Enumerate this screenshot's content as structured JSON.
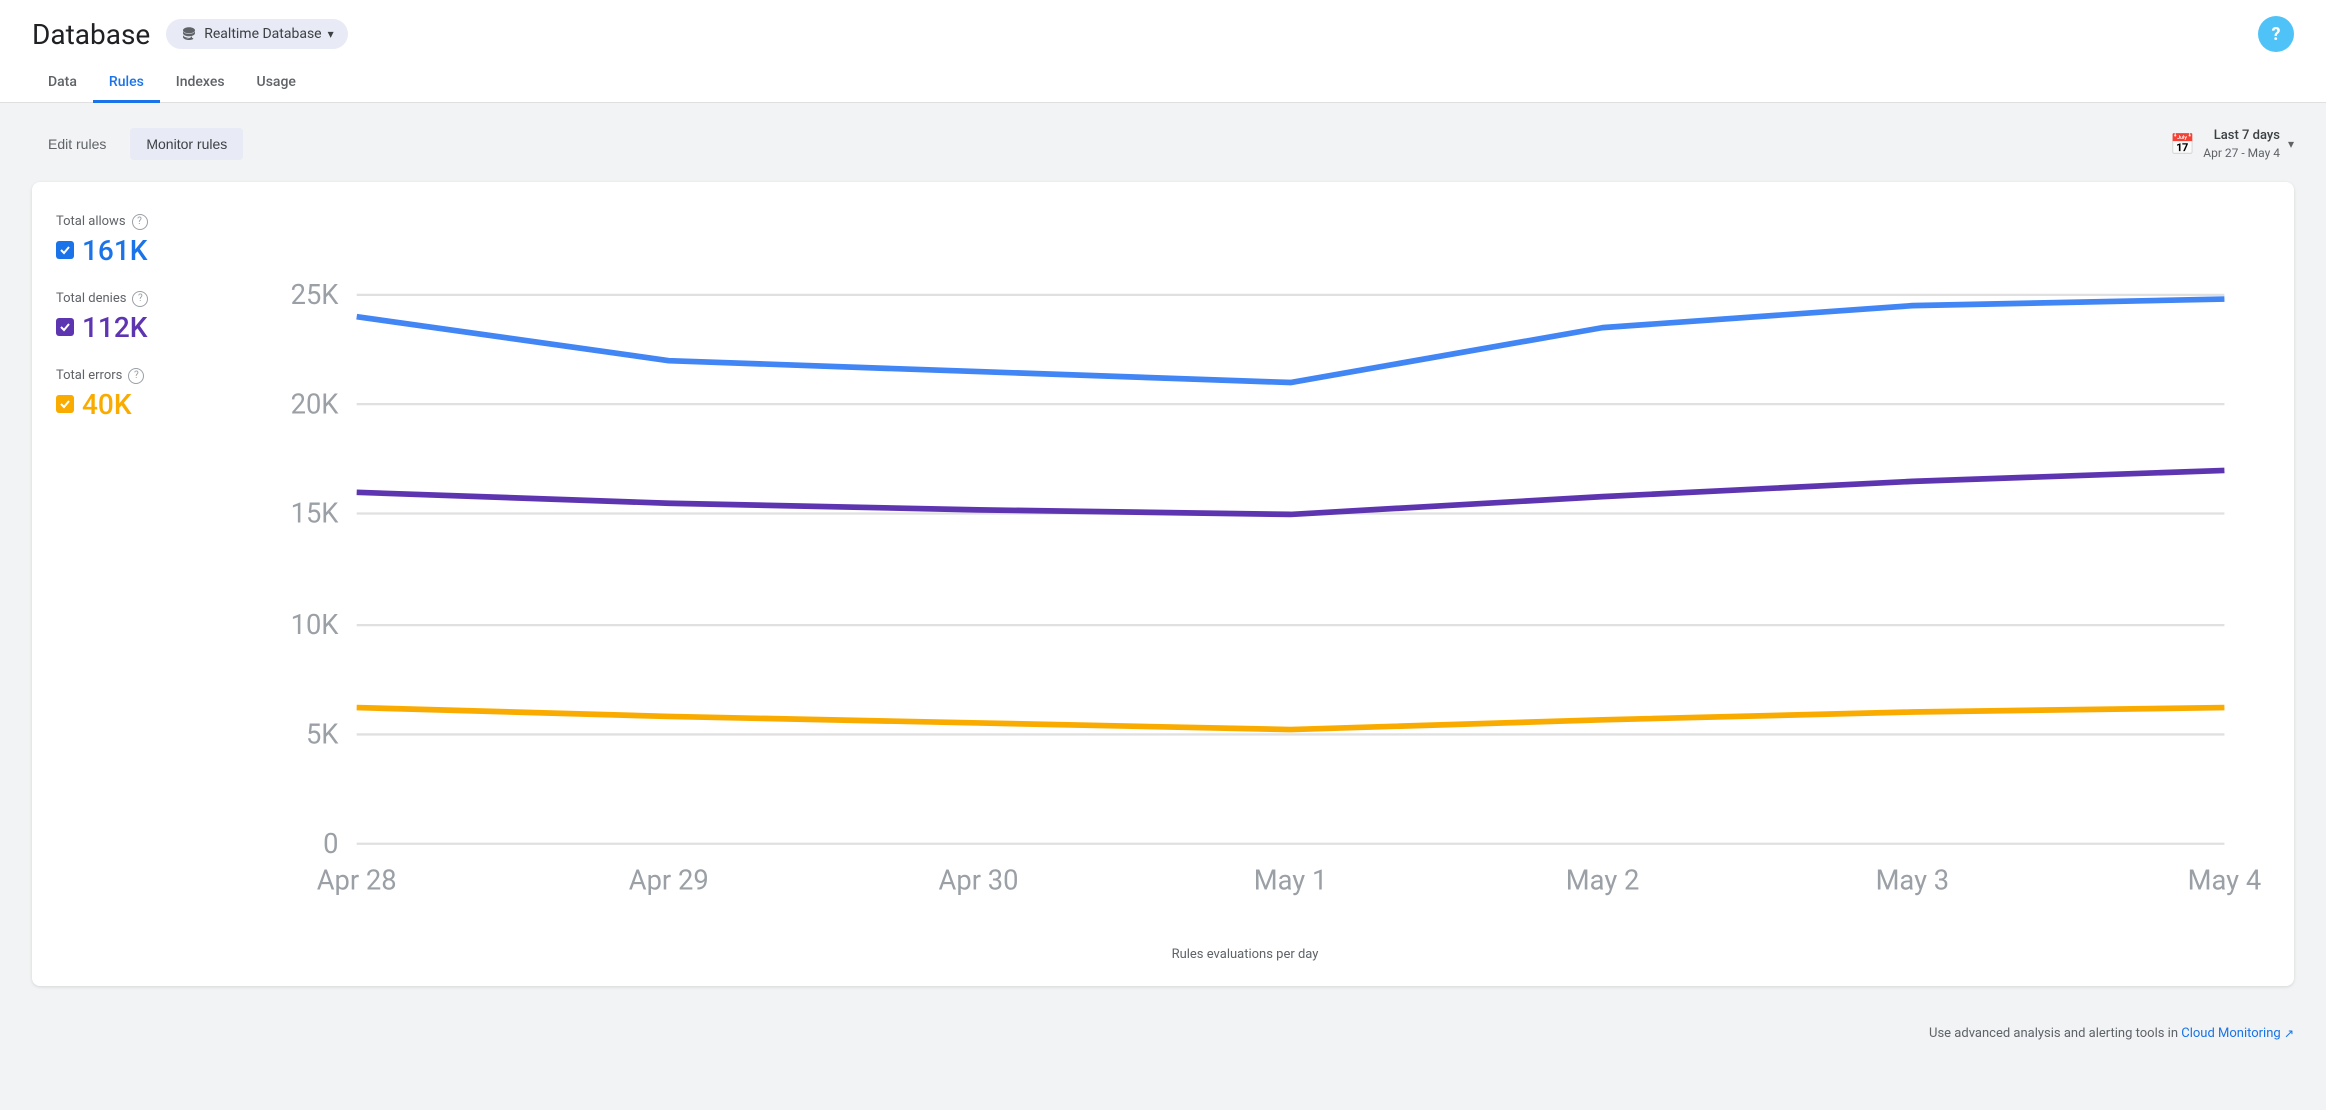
{
  "page": {
    "title": "Database",
    "help_label": "?"
  },
  "db_selector": {
    "label": "Realtime Database",
    "icon": "database-icon"
  },
  "nav": {
    "tabs": [
      {
        "id": "data",
        "label": "Data",
        "active": false
      },
      {
        "id": "rules",
        "label": "Rules",
        "active": true
      },
      {
        "id": "indexes",
        "label": "Indexes",
        "active": false
      },
      {
        "id": "usage",
        "label": "Usage",
        "active": false
      }
    ]
  },
  "toolbar": {
    "edit_rules_label": "Edit rules",
    "monitor_rules_label": "Monitor rules",
    "date_range_label": "Last 7 days",
    "date_range_sub": "Apr 27 - May 4"
  },
  "legends": {
    "allows": {
      "label": "Total allows",
      "value": "161K",
      "class": "allows"
    },
    "denies": {
      "label": "Total denies",
      "value": "112K",
      "class": "denies"
    },
    "errors": {
      "label": "Total errors",
      "value": "40K",
      "class": "errors"
    }
  },
  "chart": {
    "y_labels": [
      "25K",
      "20K",
      "15K",
      "10K",
      "5K",
      "0"
    ],
    "x_labels": [
      "Apr 28",
      "Apr 29",
      "Apr 30",
      "May 1",
      "May 2",
      "May 3",
      "May 4"
    ],
    "x_axis_label": "Rules evaluations per day",
    "series": {
      "allows": {
        "color": "#4285f4",
        "points": [
          24000,
          22000,
          21500,
          21000,
          23500,
          24500,
          24800
        ]
      },
      "denies": {
        "color": "#5e35b1",
        "points": [
          16000,
          15500,
          15200,
          15000,
          15800,
          16500,
          17000
        ]
      },
      "errors": {
        "color": "#f9ab00",
        "points": [
          6200,
          5800,
          5500,
          5200,
          5600,
          6000,
          6200
        ]
      }
    }
  },
  "footer": {
    "text": "Use advanced analysis and alerting tools in",
    "link_label": "Cloud Monitoring"
  }
}
